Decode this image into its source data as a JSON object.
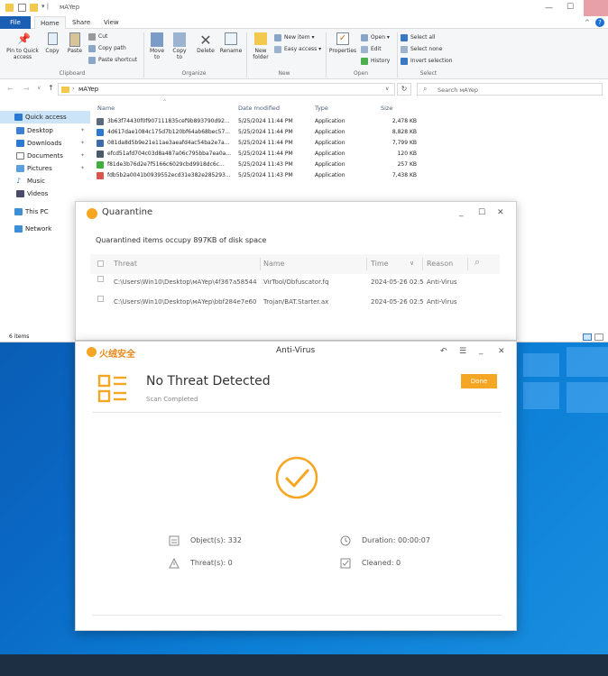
{
  "explorer": {
    "title": "мАYep",
    "tabs": [
      "File",
      "Home",
      "Share",
      "View"
    ],
    "ribbon": {
      "clipboard": {
        "pin": "Pin to Quick access",
        "copy": "Copy",
        "paste": "Paste",
        "cut": "Cut",
        "copy_path": "Copy path",
        "paste_shortcut": "Paste shortcut",
        "group": "Clipboard"
      },
      "organize": {
        "move_to": "Move to",
        "copy_to": "Copy to",
        "delete": "Delete",
        "rename": "Rename",
        "group": "Organize"
      },
      "new": {
        "new_folder": "New folder",
        "new_item": "New item ▾",
        "easy_access": "Easy access ▾",
        "group": "New"
      },
      "open": {
        "properties": "Properties",
        "open": "Open ▾",
        "edit": "Edit",
        "history": "History",
        "group": "Open"
      },
      "select": {
        "select_all": "Select all",
        "select_none": "Select none",
        "invert": "Invert selection",
        "group": "Select"
      }
    },
    "address": {
      "path": "мАYep",
      "search_placeholder": "Search мАYep"
    },
    "nav": {
      "quick_access": "Quick access",
      "desktop": "Desktop",
      "downloads": "Downloads",
      "documents": "Documents",
      "pictures": "Pictures",
      "music": "Music",
      "videos": "Videos",
      "this_pc": "This PC",
      "network": "Network"
    },
    "columns": {
      "name": "Name",
      "date": "Date modified",
      "type": "Type",
      "size": "Size"
    },
    "files": [
      {
        "name": "3b63f74430f0f907111835cef9b893790d92...",
        "date": "5/25/2024 11:44 PM",
        "type": "Application",
        "size": "2,478 KB",
        "icon_color": "#5a6b7c"
      },
      {
        "name": "4d617dae1084c175d7b120bf64ab68bec57...",
        "date": "5/25/2024 11:44 PM",
        "type": "Application",
        "size": "8,828 KB",
        "icon_color": "#2a7ad1"
      },
      {
        "name": "081da8d5b9e21e11ae3aeafd4ac54ba2e7a...",
        "date": "5/25/2024 11:44 PM",
        "type": "Application",
        "size": "7,799 KB",
        "icon_color": "#3d6aa8"
      },
      {
        "name": "efcd51afd704c03d8a487a06c795bba7ea0a...",
        "date": "5/25/2024 11:44 PM",
        "type": "Application",
        "size": "120 KB",
        "icon_color": "#4b5a6a"
      },
      {
        "name": "f81de3b76d2e7f5166c6029cbd9918dc6c...",
        "date": "5/25/2024 11:43 PM",
        "type": "Application",
        "size": "257 KB",
        "icon_color": "#3fae3a"
      },
      {
        "name": "fdb5b2a0041b0939552ecd31e382e285293...",
        "date": "5/25/2024 11:43 PM",
        "type": "Application",
        "size": "7,438 KB",
        "icon_color": "#d9534f"
      }
    ],
    "status": "6 items"
  },
  "quarantine": {
    "title": "Quarantine",
    "summary": "Quarantined items occupy 897KB of disk space",
    "columns": {
      "threat": "Threat",
      "name": "Name",
      "time": "Time",
      "reason": "Reason"
    },
    "rows": [
      {
        "threat": "C:\\Users\\Win10\\Desktop\\мАYep\\4f367a58544",
        "name": "VirTool/Obfuscator.fq",
        "time": "2024-05-26 02:5",
        "reason": "Anti-Virus"
      },
      {
        "threat": "C:\\Users\\Win10\\Desktop\\мАYep\\bbf284e7e60",
        "name": "Trojan/BAT.Starter.ax",
        "time": "2024-05-26 02:5",
        "reason": "Anti-Virus"
      }
    ]
  },
  "antivirus": {
    "brand": "火绒安全",
    "title": "Anti-Virus",
    "result_title": "No Threat Detected",
    "result_sub": "Scan Completed",
    "done_label": "Done",
    "objects": "Object(s): 332",
    "duration": "Duration: 00:00:07",
    "threats": "Threat(s): 0",
    "cleaned": "Cleaned: 0",
    "accent": "#f5a623"
  }
}
